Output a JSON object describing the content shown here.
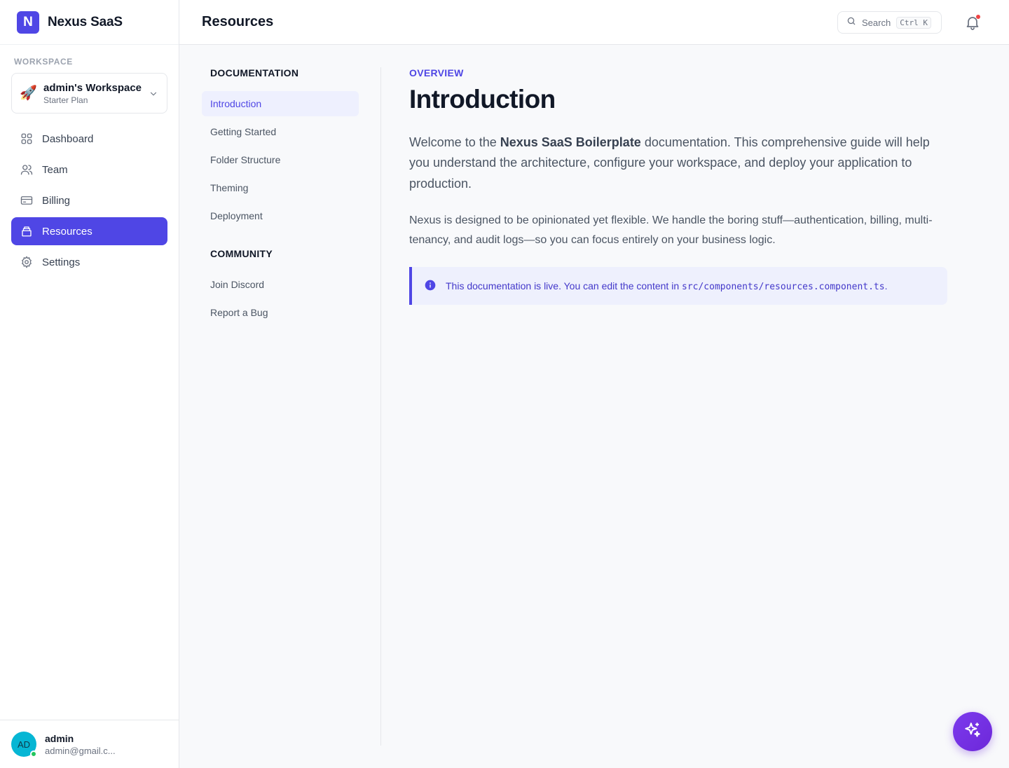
{
  "brand": {
    "logo_letter": "N",
    "name": "Nexus SaaS",
    "accent": "#4f46e5"
  },
  "workspace": {
    "section_label": "WORKSPACE",
    "emoji": "🚀",
    "name": "admin's Workspace",
    "plan": "Starter Plan",
    "chevron_icon": "chevron-down-icon"
  },
  "sidebar": {
    "items": [
      {
        "label": "Dashboard",
        "icon": "grid-icon",
        "active": false
      },
      {
        "label": "Team",
        "icon": "users-icon",
        "active": false
      },
      {
        "label": "Billing",
        "icon": "credit-card-icon",
        "active": false
      },
      {
        "label": "Resources",
        "icon": "book-icon",
        "active": true
      },
      {
        "label": "Settings",
        "icon": "gear-icon",
        "active": false
      }
    ]
  },
  "user": {
    "initials": "AD",
    "name": "admin",
    "email": "admin@gmail.c...",
    "status_color": "#22c55e"
  },
  "header": {
    "title": "Resources",
    "search_label": "Search",
    "search_shortcut": "Ctrl K",
    "bell_icon": "bell-icon"
  },
  "docnav": {
    "sections": [
      {
        "heading": "DOCUMENTATION",
        "items": [
          "Introduction",
          "Getting Started",
          "Folder Structure",
          "Theming",
          "Deployment"
        ]
      },
      {
        "heading": "COMMUNITY",
        "items": [
          "Join Discord",
          "Report a Bug"
        ]
      }
    ],
    "active": "Introduction"
  },
  "article": {
    "eyebrow": "OVERVIEW",
    "title": "Introduction",
    "lead_before": "Welcome to the ",
    "lead_bold": "Nexus SaaS Boilerplate",
    "lead_after": " documentation. This comprehensive guide will help you understand the architecture, configure your workspace, and deploy your application to production.",
    "body": "Nexus is designed to be opinionated yet flexible. We handle the boring stuff—authentication, billing, multi-tenancy, and audit logs—so you can focus entirely on your business logic.",
    "callout_text": "This documentation is live. You can edit the content in ",
    "callout_code": "src/components/resources.component.ts",
    "callout_end": ".",
    "callout_icon": "info-icon"
  },
  "fab": {
    "icon": "sparkles-icon"
  }
}
